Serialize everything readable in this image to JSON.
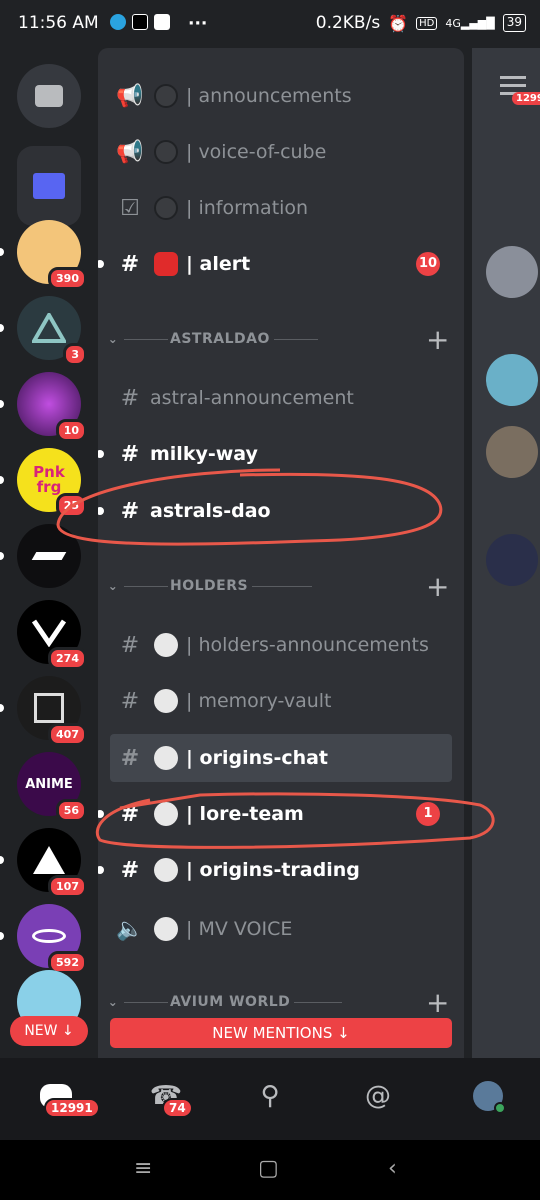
{
  "status_bar": {
    "time": "11:56 AM",
    "speed": "0.2KB/s",
    "battery": "39",
    "network": "4G"
  },
  "servers": [
    {
      "name": "dm",
      "badge": ""
    },
    {
      "name": "folder",
      "badge": ""
    },
    {
      "name": "server-1",
      "badge": "390"
    },
    {
      "name": "server-2",
      "badge": "3"
    },
    {
      "name": "server-3",
      "badge": "10"
    },
    {
      "name": "pnk-frg",
      "badge": "25",
      "label": "Pnk frg"
    },
    {
      "name": "server-5",
      "badge": ""
    },
    {
      "name": "server-6",
      "badge": "274"
    },
    {
      "name": "server-7",
      "badge": "407"
    },
    {
      "name": "anime",
      "badge": "56",
      "label": "ANIME"
    },
    {
      "name": "server-9",
      "badge": "107"
    },
    {
      "name": "server-10",
      "badge": "592"
    },
    {
      "name": "server-11",
      "badge": ""
    }
  ],
  "new_pill": "NEW ↓",
  "channels_top": [
    {
      "name": "| announcements",
      "type": "announce"
    },
    {
      "name": "| voice-of-cube",
      "type": "announce"
    },
    {
      "name": "| information",
      "type": "rules"
    },
    {
      "name": "| alert",
      "type": "text",
      "unread": true,
      "mention": "10"
    }
  ],
  "categories": [
    {
      "name": "ASTRALDAO"
    },
    {
      "name": "HOLDERS"
    },
    {
      "name": "AVIUM WORLD"
    }
  ],
  "astraldao": [
    {
      "name": "astral-announcement"
    },
    {
      "name": "milky-way"
    },
    {
      "name": "astrals-dao"
    }
  ],
  "holders": [
    {
      "name": "| holders-announcements"
    },
    {
      "name": "| memory-vault"
    },
    {
      "name": "| origins-chat"
    },
    {
      "name": "| lore-team",
      "mention": "1"
    },
    {
      "name": "| origins-trading"
    },
    {
      "name": "| MV VOICE"
    }
  ],
  "new_mentions": "NEW MENTIONS ↓",
  "peek": {
    "badge": "1299"
  },
  "bottom_nav": {
    "home_badge": "12991",
    "friends_badge": "74"
  },
  "colors": {
    "mention": "#ed4245",
    "annotation": "#e8584a"
  }
}
